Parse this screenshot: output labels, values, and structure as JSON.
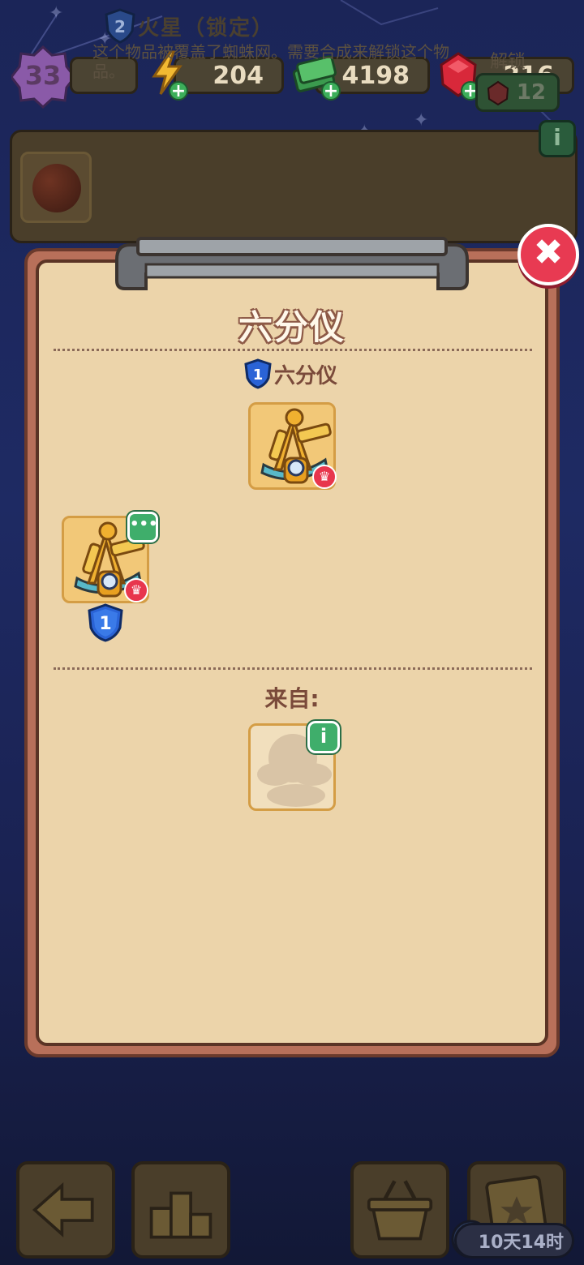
{
  "player": {
    "level": "33"
  },
  "resources": {
    "energy": "204",
    "cash": "4198",
    "gems": "216"
  },
  "info_card": {
    "level": "2",
    "title": "火星（锁定）",
    "description": "这个物品被覆盖了蜘蛛网。需要合成来解锁这个物品。",
    "unlock_label": "解锁",
    "unlock_cost": "12",
    "info_icon": "i"
  },
  "modal": {
    "title": "六分仪",
    "chain_level": "1",
    "chain_name": "六分仪",
    "item_level": "1",
    "more_icon": "•••",
    "from_label": "来自:",
    "source_info_icon": "i",
    "close_icon": "✖"
  },
  "bottom_nav": {
    "timer": "10天14时"
  },
  "colors": {
    "accent_red": "#e83a52",
    "accent_green": "#3fae6b",
    "panel": "#ecd4aa",
    "level_blue": "#2a63d6"
  }
}
